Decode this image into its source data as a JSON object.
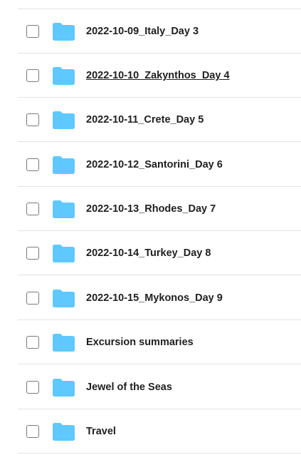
{
  "folder_color": "#5fc8ff",
  "folders": [
    {
      "name": "2022-10-09_Italy_Day 3",
      "hovered": false
    },
    {
      "name": "2022-10-10_Zakynthos_Day 4",
      "hovered": true
    },
    {
      "name": "2022-10-11_Crete_Day 5",
      "hovered": false
    },
    {
      "name": "2022-10-12_Santorini_Day 6",
      "hovered": false
    },
    {
      "name": "2022-10-13_Rhodes_Day 7",
      "hovered": false
    },
    {
      "name": "2022-10-14_Turkey_Day 8",
      "hovered": false
    },
    {
      "name": "2022-10-15_Mykonos_Day 9",
      "hovered": false
    },
    {
      "name": "Excursion summaries",
      "hovered": false
    },
    {
      "name": "Jewel of the Seas",
      "hovered": false
    },
    {
      "name": "Travel",
      "hovered": false
    }
  ]
}
